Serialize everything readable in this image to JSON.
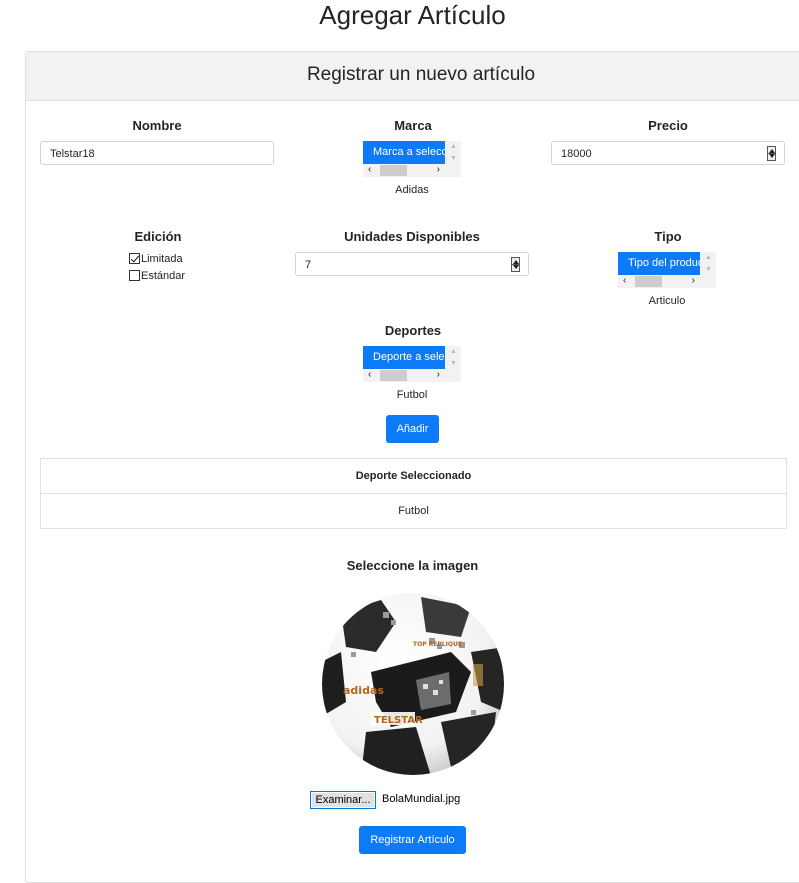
{
  "page": {
    "title": "Agregar Artículo"
  },
  "card": {
    "header": "Registrar un nuevo artículo"
  },
  "form": {
    "nombre": {
      "label": "Nombre",
      "value": "Telstar18"
    },
    "marca": {
      "label": "Marca",
      "option": "Marca a seleccionar",
      "selected": "Adidas"
    },
    "precio": {
      "label": "Precio",
      "value": "18000"
    },
    "edicion": {
      "label": "Edición",
      "options": [
        {
          "label": "Limitada",
          "checked": true
        },
        {
          "label": "Estándar",
          "checked": false
        }
      ]
    },
    "unidades": {
      "label": "Unidades Disponibles",
      "value": "7"
    },
    "tipo": {
      "label": "Tipo",
      "option": "Tipo del producto",
      "selected": "Articulo"
    },
    "deportes": {
      "label": "Deportes",
      "option": "Deporte a seleccionar",
      "selected": "Futbol"
    },
    "add_button": "Añadir"
  },
  "table": {
    "header": "Deporte Seleccionado",
    "rows": [
      "Futbol"
    ]
  },
  "image": {
    "label": "Seleccione la imagen",
    "browse_button": "Examinar...",
    "file_name": "BolaMundial.jpg",
    "ball_text": {
      "brand": "adidas",
      "model": "TELSTAR",
      "model_sub": "18",
      "replique": "TOP REPLIQUE"
    }
  },
  "submit_button": "Registrar Artículo",
  "colors": {
    "primary": "#0d7bf7",
    "header_bg": "#f2f2f2"
  }
}
